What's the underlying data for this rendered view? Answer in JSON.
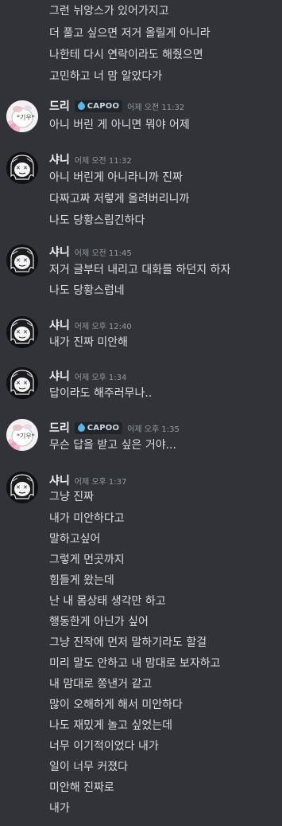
{
  "messages": [
    {
      "lines": [
        "그런 뉘앙스가 있어가지고",
        "더 풀고 싶으면 저거 올릴게 아니라",
        "나한테 다시 연락이라도 해줬으면",
        "고민하고 너 맘 알았다가"
      ]
    },
    {
      "author": "드리",
      "tag": "CAPOO",
      "time": "어제 오전 11:32",
      "avatar": "dri",
      "lines": [
        "아니 버린 게 아니면 뭐야 어제"
      ]
    },
    {
      "author": "샤니",
      "time": "어제 오전 11:32",
      "avatar": "shany",
      "lines": [
        "아니 버린게 아니라니까 진짜",
        "다짜고짜 저렇게 올려버리니까",
        "나도 당황스립긴하다"
      ]
    },
    {
      "author": "샤니",
      "time": "어제 오전 11:45",
      "avatar": "shany",
      "lines": [
        "저거 글부터 내리고 대화를 하던지 하자",
        "나도 당황스럽네"
      ]
    },
    {
      "author": "샤니",
      "time": "어제 오후 12:40",
      "avatar": "shany",
      "lines": [
        "내가 진짜 미안해"
      ]
    },
    {
      "author": "샤니",
      "time": "어제 오후 1:34",
      "avatar": "shany",
      "lines": [
        "답이라도 해주러무나.."
      ]
    },
    {
      "author": "드리",
      "tag": "CAPOO",
      "time": "어제 오후 1:35",
      "avatar": "dri",
      "lines": [
        "무슨 답을 받고 싶은 거야..."
      ]
    },
    {
      "author": "샤니",
      "time": "어제 오후 1:37",
      "avatar": "shany",
      "lines": [
        "그냥 진짜",
        "내가 미안하다고",
        "말하고싶어",
        "그렇게 먼곳까지",
        "힘들게 왔는데",
        "난 내 몸상태 생각만 하고",
        "행동한게 아닌가 싶어",
        "그냥 진작에 먼저 말하기라도 할걸",
        "미리 말도 안하고 내 맘대로 보자하고",
        "내 맘대로 쫑낸거 같고",
        "많이 오해하게 해서 미안하다",
        "나도 재밌게 놀고 싶었는데",
        "너무 이기적이었다 내가",
        "일이 너무 커졌다",
        "미안해 진짜로",
        "내가"
      ]
    }
  ]
}
